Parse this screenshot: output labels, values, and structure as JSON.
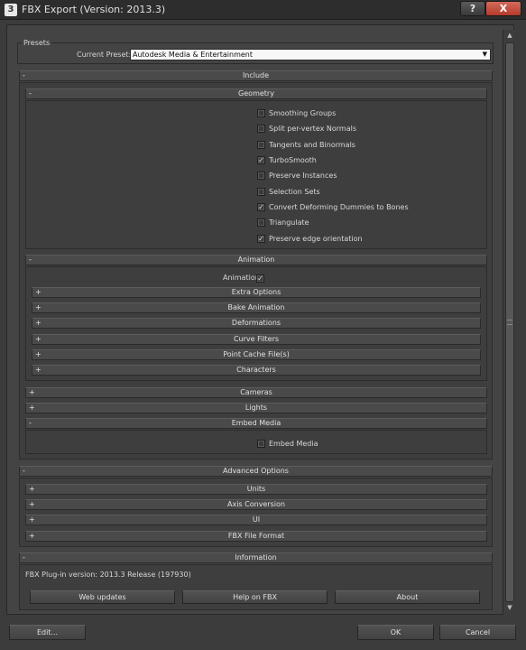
{
  "window": {
    "title": "FBX Export (Version: 2013.3)",
    "help_label": "?",
    "close_label": "X"
  },
  "presets": {
    "group_label": "Presets",
    "current_preset_label": "Current Preset:",
    "current_preset_value": "Autodesk Media & Entertainment"
  },
  "include": {
    "header": "Include",
    "sign": "-",
    "geometry": {
      "header": "Geometry",
      "sign": "-",
      "options": [
        {
          "label": "Smoothing Groups",
          "checked": false
        },
        {
          "label": "Split per-vertex Normals",
          "checked": false
        },
        {
          "label": "Tangents and Binormals",
          "checked": false
        },
        {
          "label": "TurboSmooth",
          "checked": true
        },
        {
          "label": "Preserve Instances",
          "checked": false
        },
        {
          "label": "Selection Sets",
          "checked": false
        },
        {
          "label": "Convert Deforming Dummies to Bones",
          "checked": true
        },
        {
          "label": "Triangulate",
          "checked": false
        },
        {
          "label": "Preserve edge orientation",
          "checked": true
        }
      ]
    },
    "animation": {
      "header": "Animation",
      "sign": "-",
      "animation_label": "Animation",
      "animation_checked": true,
      "subrollouts": [
        {
          "sign": "+",
          "label": "Extra Options"
        },
        {
          "sign": "+",
          "label": "Bake Animation"
        },
        {
          "sign": "+",
          "label": "Deformations"
        },
        {
          "sign": "+",
          "label": "Curve Filters"
        },
        {
          "sign": "+",
          "label": "Point Cache File(s)"
        },
        {
          "sign": "+",
          "label": "Characters"
        }
      ]
    },
    "cameras": {
      "sign": "+",
      "label": "Cameras"
    },
    "lights": {
      "sign": "+",
      "label": "Lights"
    },
    "embed_media": {
      "sign": "-",
      "header": "Embed Media",
      "option_label": "Embed Media",
      "option_checked": false
    }
  },
  "advanced": {
    "header": "Advanced Options",
    "sign": "-",
    "subrollouts": [
      {
        "sign": "+",
        "label": "Units"
      },
      {
        "sign": "+",
        "label": "Axis Conversion"
      },
      {
        "sign": "+",
        "label": "UI"
      },
      {
        "sign": "+",
        "label": "FBX File Format"
      }
    ]
  },
  "information": {
    "header": "Information",
    "sign": "-",
    "version_text": "FBX Plug-in version: 2013.3 Release (197930)",
    "buttons": {
      "web_updates": "Web updates",
      "help_on_fbx": "Help on FBX",
      "about": "About"
    }
  },
  "footer": {
    "edit": "Edit...",
    "ok": "OK",
    "cancel": "Cancel"
  }
}
